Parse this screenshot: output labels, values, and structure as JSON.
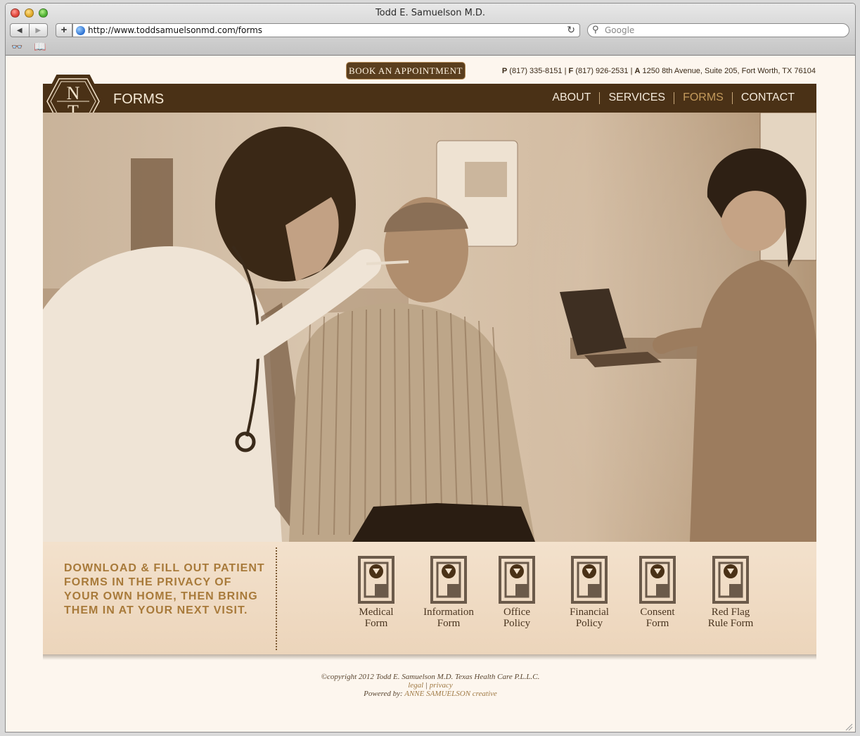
{
  "browser": {
    "title": "Todd E. Samuelson M.D.",
    "url": "http://www.toddsamuelsonmd.com/forms",
    "search_placeholder": "Google"
  },
  "header": {
    "book_button": "BOOK AN APPOINTMENT",
    "phone_label": "P",
    "phone": "(817) 335-8151",
    "fax_label": "F",
    "fax": "(817) 926-2531",
    "address_label": "A",
    "address": "1250 8th Avenue, Suite 205, Fort Worth, TX 76104",
    "page_title": "FORMS"
  },
  "logo": {
    "letters": [
      "N",
      "T"
    ]
  },
  "nav": [
    "ABOUT",
    "SERVICES",
    "FORMS",
    "CONTACT"
  ],
  "promo": "DOWNLOAD & FILL OUT PATIENT FORMS IN THE PRIVACY OF YOUR OWN HOME, THEN BRING THEM IN AT YOUR NEXT VISIT.",
  "forms": [
    {
      "label": "Medical\nForm",
      "icon": "download-form-icon"
    },
    {
      "label": "Information\nForm",
      "icon": "download-form-icon"
    },
    {
      "label": "Office\nPolicy",
      "icon": "download-form-icon"
    },
    {
      "label": "Financial\nPolicy",
      "icon": "download-form-icon"
    },
    {
      "label": "Consent\nForm",
      "icon": "download-form-icon"
    },
    {
      "label": "Red Flag\nRule Form",
      "icon": "download-form-icon"
    }
  ],
  "footer": {
    "copyright": "©copyright 2012 Todd E. Samuelson M.D.   Texas Health Care P.L.L.C.",
    "legal": "legal",
    "privacy": "privacy",
    "powered_prefix": "Powered by:",
    "powered_link": "ANNE SAMUELSON creative"
  },
  "colors": {
    "brand_brown": "#4a3116",
    "accent_gold": "#c39a5c",
    "promo_text": "#a87a3a",
    "page_bg": "#fdf6ee"
  }
}
